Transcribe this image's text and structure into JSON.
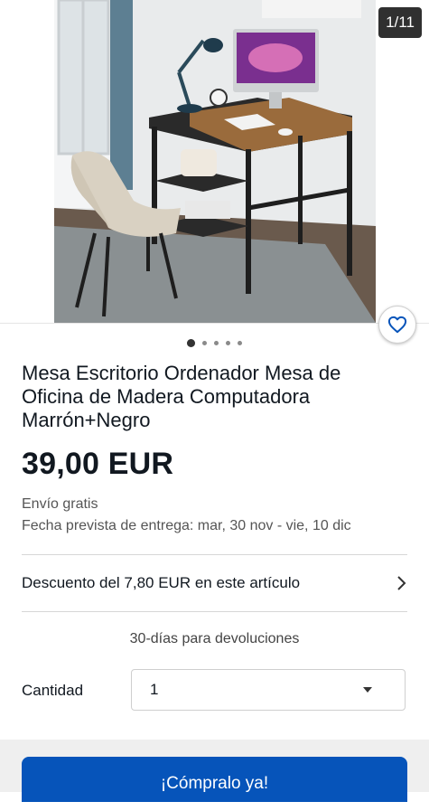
{
  "gallery": {
    "counter": "1/11",
    "dots_total": 5,
    "dots_active_index": 0,
    "favorite_icon": "heart-outline-icon"
  },
  "product": {
    "title": "Mesa Escritorio Ordenador Mesa de Oficina de Madera Computadora Marrón+Negro",
    "price": "39,00 EUR",
    "shipping": "Envío gratis",
    "delivery": "Fecha prevista de entrega: mar, 30 nov - vie, 10 dic"
  },
  "discount": {
    "label": "Descuento del 7,80 EUR en este artículo",
    "icon": "chevron-right-icon"
  },
  "returns": {
    "label": "30-días para devoluciones"
  },
  "quantity": {
    "label": "Cantidad",
    "value": "1",
    "icon": "caret-down-icon"
  },
  "cta": {
    "buy_label": "¡Cómpralo ya!"
  },
  "colors": {
    "primary_button": "#0654ba",
    "favorite": "#0654ba",
    "text": "#111820"
  }
}
